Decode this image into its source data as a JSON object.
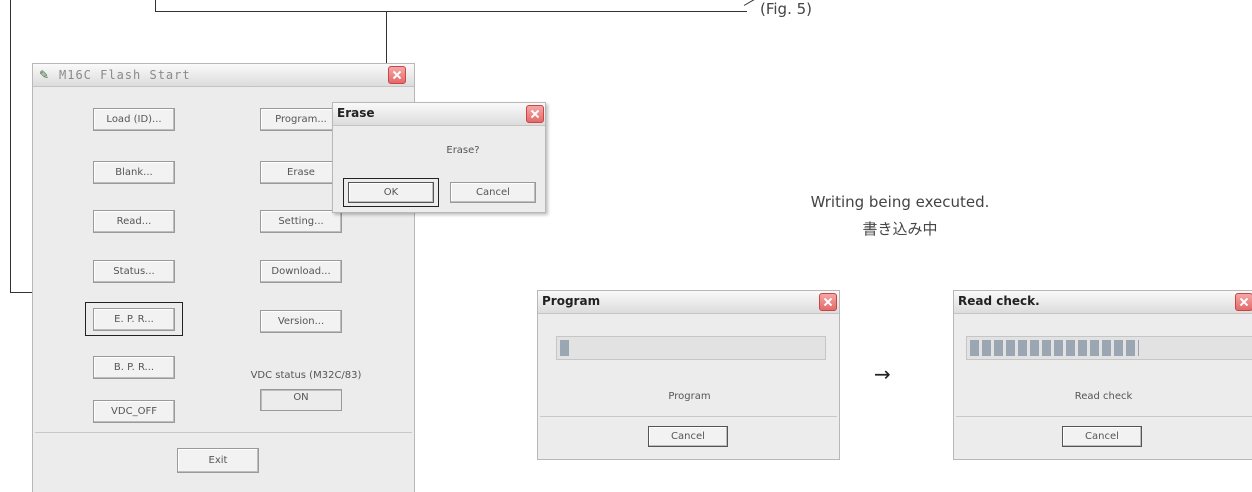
{
  "fig_label": "(Fig. 5)",
  "caption": {
    "en": "Writing being executed.",
    "ja": "書き込み中"
  },
  "main_window": {
    "title": "M16C Flash Start",
    "buttons": {
      "load": "Load (ID)...",
      "program": "Program...",
      "blank": "Blank...",
      "erase": "Erase",
      "read": "Read...",
      "setting": "Setting...",
      "status": "Status...",
      "download": "Download...",
      "epr": "E. P. R...",
      "version": "Version...",
      "bpr": "B. P. R...",
      "vdc_off": "VDC_OFF",
      "exit": "Exit"
    },
    "vdc_status_label": "VDC status (M32C/83)",
    "vdc_status_value": "ON"
  },
  "erase_dialog": {
    "title": "Erase",
    "message": "Erase?",
    "ok": "OK",
    "cancel": "Cancel"
  },
  "program_dialog": {
    "title": "Program",
    "status": "Program",
    "cancel": "Cancel",
    "progress": 0.04
  },
  "readcheck_dialog": {
    "title": "Read check.",
    "status": "Read check",
    "cancel": "Cancel",
    "progress": 0.6
  },
  "arrow": "→"
}
